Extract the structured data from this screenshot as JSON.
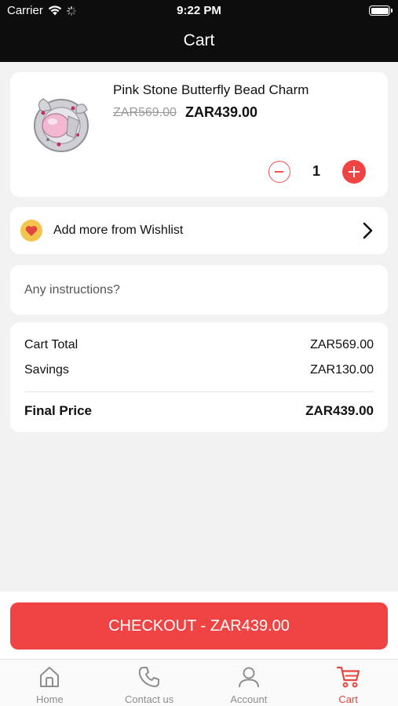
{
  "status_bar": {
    "carrier": "Carrier",
    "time": "9:22 PM"
  },
  "nav": {
    "title": "Cart"
  },
  "cart_item": {
    "name": "Pink Stone Butterfly Bead Charm",
    "original_price": "ZAR569.00",
    "sale_price": "ZAR439.00",
    "quantity": "1"
  },
  "wishlist": {
    "label": "Add more from Wishlist"
  },
  "instructions": {
    "placeholder": "Any instructions?",
    "value": ""
  },
  "summary": {
    "cart_total_label": "Cart Total",
    "cart_total_value": "ZAR569.00",
    "savings_label": "Savings",
    "savings_value": "ZAR130.00",
    "final_label": "Final Price",
    "final_value": "ZAR439.00"
  },
  "checkout": {
    "label": "CHECKOUT - ZAR439.00"
  },
  "tabs": [
    {
      "label": "Home",
      "icon": "home-icon",
      "active": false
    },
    {
      "label": "Contact us",
      "icon": "phone-icon",
      "active": false
    },
    {
      "label": "Account",
      "icon": "user-icon",
      "active": false
    },
    {
      "label": "Cart",
      "icon": "cart-icon",
      "active": true
    }
  ],
  "colors": {
    "accent": "#f04444",
    "heart_badge": "#f3c54d",
    "header_bg": "#0d0d0d",
    "active_tab": "#e8453c"
  }
}
